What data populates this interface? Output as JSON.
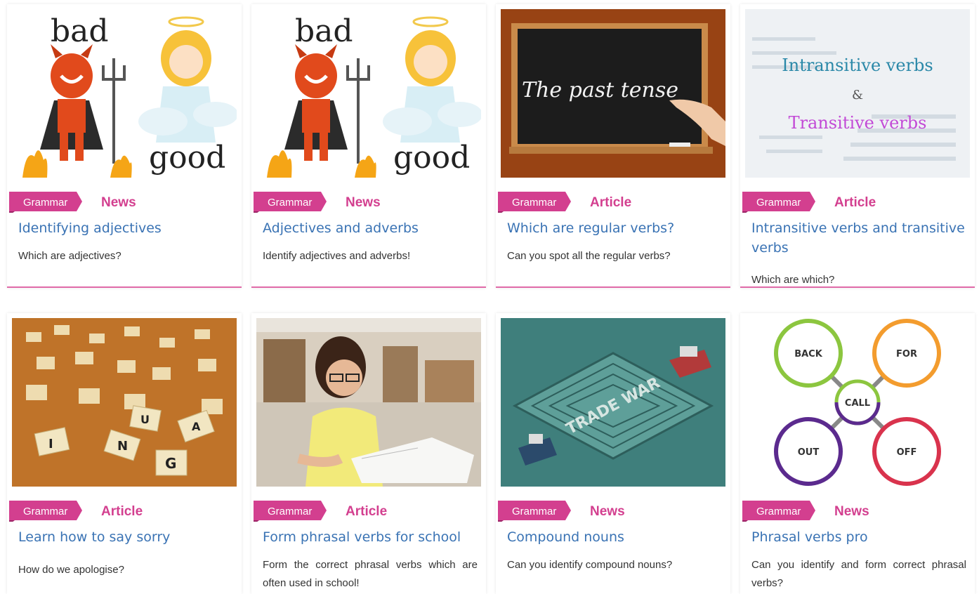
{
  "accent": "#d33f8f",
  "title_color": "#3a73b4",
  "cards": [
    {
      "category": "Grammar",
      "type": "News",
      "title": "Identifying adjectives",
      "description": "Which are adjectives?",
      "image": {
        "top_word": "bad",
        "bottom_word": "good"
      }
    },
    {
      "category": "Grammar",
      "type": "News",
      "title": "Adjectives and adverbs",
      "description": "Identify adjectives and adverbs!",
      "image": {
        "top_word": "bad",
        "bottom_word": "good"
      }
    },
    {
      "category": "Grammar",
      "type": "Article",
      "title": "Which are regular verbs?",
      "description": "Can you spot all the regular verbs?",
      "image": {
        "chalk_text": "The past tense"
      }
    },
    {
      "category": "Grammar",
      "type": "Article",
      "title": "Intransitive verbs and transitive verbs",
      "description": "Which are which?",
      "image": {
        "line1": "Intransitive verbs",
        "line2": "&",
        "line3": "Transitive verbs"
      }
    },
    {
      "category": "Grammar",
      "type": "Article",
      "title": "Learn how to say sorry",
      "description": "How do we apologise?",
      "image": {
        "tiles": [
          "I",
          "N",
          "G",
          "A",
          "U"
        ]
      }
    },
    {
      "category": "Grammar",
      "type": "Article",
      "title": "Form phrasal verbs for school",
      "description": "Form the correct phrasal verbs which are often used in school!",
      "image": {}
    },
    {
      "category": "Grammar",
      "type": "News",
      "title": "Compound nouns",
      "description": "Can you identify compound nouns?",
      "image": {
        "maze_text": "TRADE WAR"
      }
    },
    {
      "category": "Grammar",
      "type": "News",
      "title": "Phrasal verbs pro",
      "description": "Can you identify and form correct phrasal verbs?",
      "image": {
        "center": "CALL",
        "nodes": [
          "BACK",
          "FOR",
          "OUT",
          "OFF"
        ]
      }
    }
  ]
}
